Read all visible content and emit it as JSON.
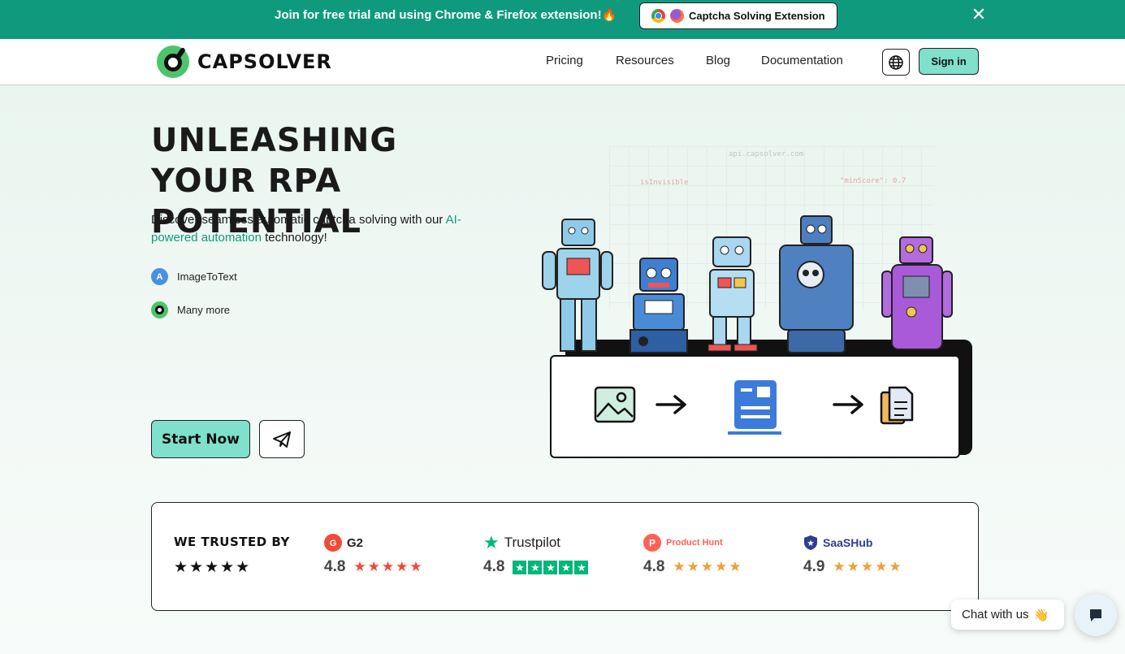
{
  "banner": {
    "text": "Join for free trial and using Chrome & Firefox extension!🔥",
    "extension_label": "Captcha Solving Extension",
    "close_icon": "close-icon",
    "bg_color": "#0f9a7e"
  },
  "header": {
    "logo_text": "CAPSOLVER",
    "nav": [
      "Pricing",
      "Resources",
      "Blog",
      "Documentation"
    ],
    "globe_icon": "globe-icon",
    "signin_label": "Sign in",
    "accent_color": "#7fe0cc"
  },
  "hero": {
    "title": "UNLEASHING YOUR RPA POTENTIAL",
    "desc_before": "Discover seamless automatic captcha solving with our ",
    "desc_accent": "AI-powered automation",
    "desc_after": " technology!",
    "features": [
      {
        "icon": "image-to-text-icon",
        "icon_letter": "A",
        "label": "ImageToText"
      },
      {
        "icon": "capsolver-icon",
        "label": "Many more"
      }
    ],
    "start_label": "Start Now",
    "telegram_icon": "telegram-icon"
  },
  "illustration": {
    "code_labels": [
      "api.capsolver.com",
      "isInvisible",
      "\"minScore\": 0.7"
    ],
    "flow_icons": [
      "image-icon",
      "arrow-right-icon",
      "document-image-icon",
      "arrow-right-icon",
      "copy-document-icon"
    ]
  },
  "trusted": {
    "title": "WE TRUSTED BY",
    "stars": "★★★★★",
    "reviews": [
      {
        "brand": "G2",
        "score": "4.8",
        "stars": "★★★★★",
        "color": "#f04b37"
      },
      {
        "brand": "Trustpilot",
        "score": "4.8",
        "stars": "★★★★★",
        "color": "#00b67a"
      },
      {
        "brand": "Product Hunt",
        "score": "4.8",
        "stars": "★★★★★",
        "color": "#ff6154"
      },
      {
        "brand": "SaaSHub",
        "score": "4.9",
        "stars": "★★★★★",
        "color": "#e8a33c"
      }
    ]
  },
  "chat": {
    "label": "Chat with us",
    "emoji": "👋"
  }
}
